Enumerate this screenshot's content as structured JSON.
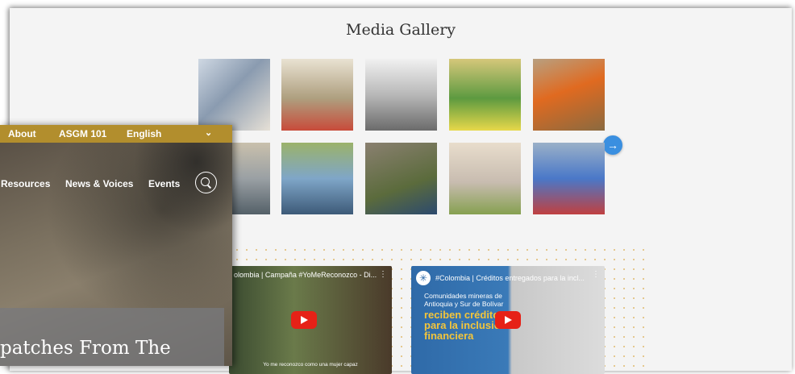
{
  "gallery": {
    "title": "Media Gallery",
    "next_icon": "arrow-right-icon",
    "row1": [
      {
        "colors": [
          "#cfd8e3",
          "#8a9bb0",
          "#e6e0d6"
        ]
      },
      {
        "colors": [
          "#e9e2d2",
          "#ae9f7f",
          "#c84b3a"
        ]
      },
      {
        "colors": [
          "#b8b8b8",
          "#6b6b6b",
          "#f1f1f1"
        ]
      },
      {
        "colors": [
          "#d5c77a",
          "#5d9a40",
          "#e7d84a"
        ]
      },
      {
        "colors": [
          "#8a6a40",
          "#e06a20",
          "#b8a080"
        ]
      }
    ],
    "row2": [
      {
        "colors": [
          "#9aa0a4",
          "#546068",
          "#c9c0ac"
        ]
      },
      {
        "colors": [
          "#7fa6c8",
          "#3d5a78",
          "#9bb26a"
        ]
      },
      {
        "colors": [
          "#8a8070",
          "#5b6b3c",
          "#2c4a6e"
        ]
      },
      {
        "colors": [
          "#c8bcb0",
          "#e8ddcc",
          "#86a050"
        ]
      },
      {
        "colors": [
          "#4a78c8",
          "#c04040",
          "#9ab0c8"
        ]
      }
    ]
  },
  "videos": [
    {
      "title": "olombia | Campaña #YoMeReconozco - Di...",
      "caption": "Yo me reconozco como una mujer capaz"
    },
    {
      "title": "#Colombia | Créditos entregados para la incl...",
      "overlay_line1": "Comunidades mineras de",
      "overlay_line2": "Antioquia y Sur de Bolívar",
      "overlay_line3": "reciben créditos",
      "overlay_line4": "para la inclusión",
      "overlay_line5": "financiera"
    }
  ],
  "topbar": {
    "items": [
      "About",
      "ASGM 101",
      "English"
    ],
    "chevron_icon": "chevron-down-icon"
  },
  "nav": {
    "items": [
      "Resources",
      "News & Voices",
      "Events"
    ],
    "search_icon": "search-icon"
  },
  "hero": {
    "headline": "patches From The"
  },
  "colors": {
    "topbar": "#b28e2d",
    "accent_blue": "#3a8fe0",
    "youtube_red": "#e62117"
  }
}
